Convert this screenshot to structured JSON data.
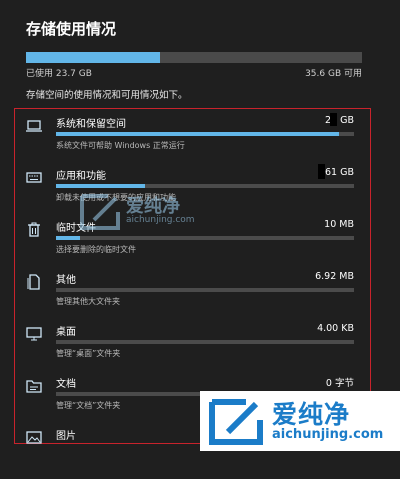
{
  "header": {
    "title": "存储使用情况",
    "usage_fraction": 0.4,
    "used_label": "已使用 23.7 GB",
    "free_label": "35.6 GB 可用",
    "description": "存储空间的使用情况和可用情况如下。"
  },
  "items": [
    {
      "name": "系统和保留空间",
      "size": "20 GB",
      "fraction": 0.95,
      "sub": "系统文件可帮助 Windows 正常运行",
      "icon": "laptop-icon"
    },
    {
      "name": "应用和功能",
      "size": ".61 GB",
      "fraction": 0.3,
      "sub": "卸载未使用或不想要的应用和功能",
      "icon": "keyboard-icon"
    },
    {
      "name": "临时文件",
      "size": "10 MB",
      "fraction": 0.08,
      "sub": "选择要删除的临时文件",
      "icon": "trash-icon"
    },
    {
      "name": "其他",
      "size": "6.92 MB",
      "fraction": 0.0,
      "sub": "管理其他大文件夹",
      "icon": "file-icon"
    },
    {
      "name": "桌面",
      "size": "4.00 KB",
      "fraction": 0.0,
      "sub": "管理“桌面”文件夹",
      "icon": "monitor-icon"
    },
    {
      "name": "文档",
      "size": "0 字节",
      "fraction": 0.0,
      "sub": "管理“文档”文件夹",
      "icon": "folder-icon"
    },
    {
      "name": "图片",
      "size": "",
      "fraction": 0.0,
      "sub": "",
      "icon": "picture-icon"
    }
  ],
  "watermark": {
    "brand": "爱纯净",
    "url": "aichunjing.com"
  },
  "colors": {
    "accent": "#62b6e8",
    "track": "#4b4b4b",
    "highlight_border": "#c8232c",
    "background": "#1f1f1f"
  }
}
